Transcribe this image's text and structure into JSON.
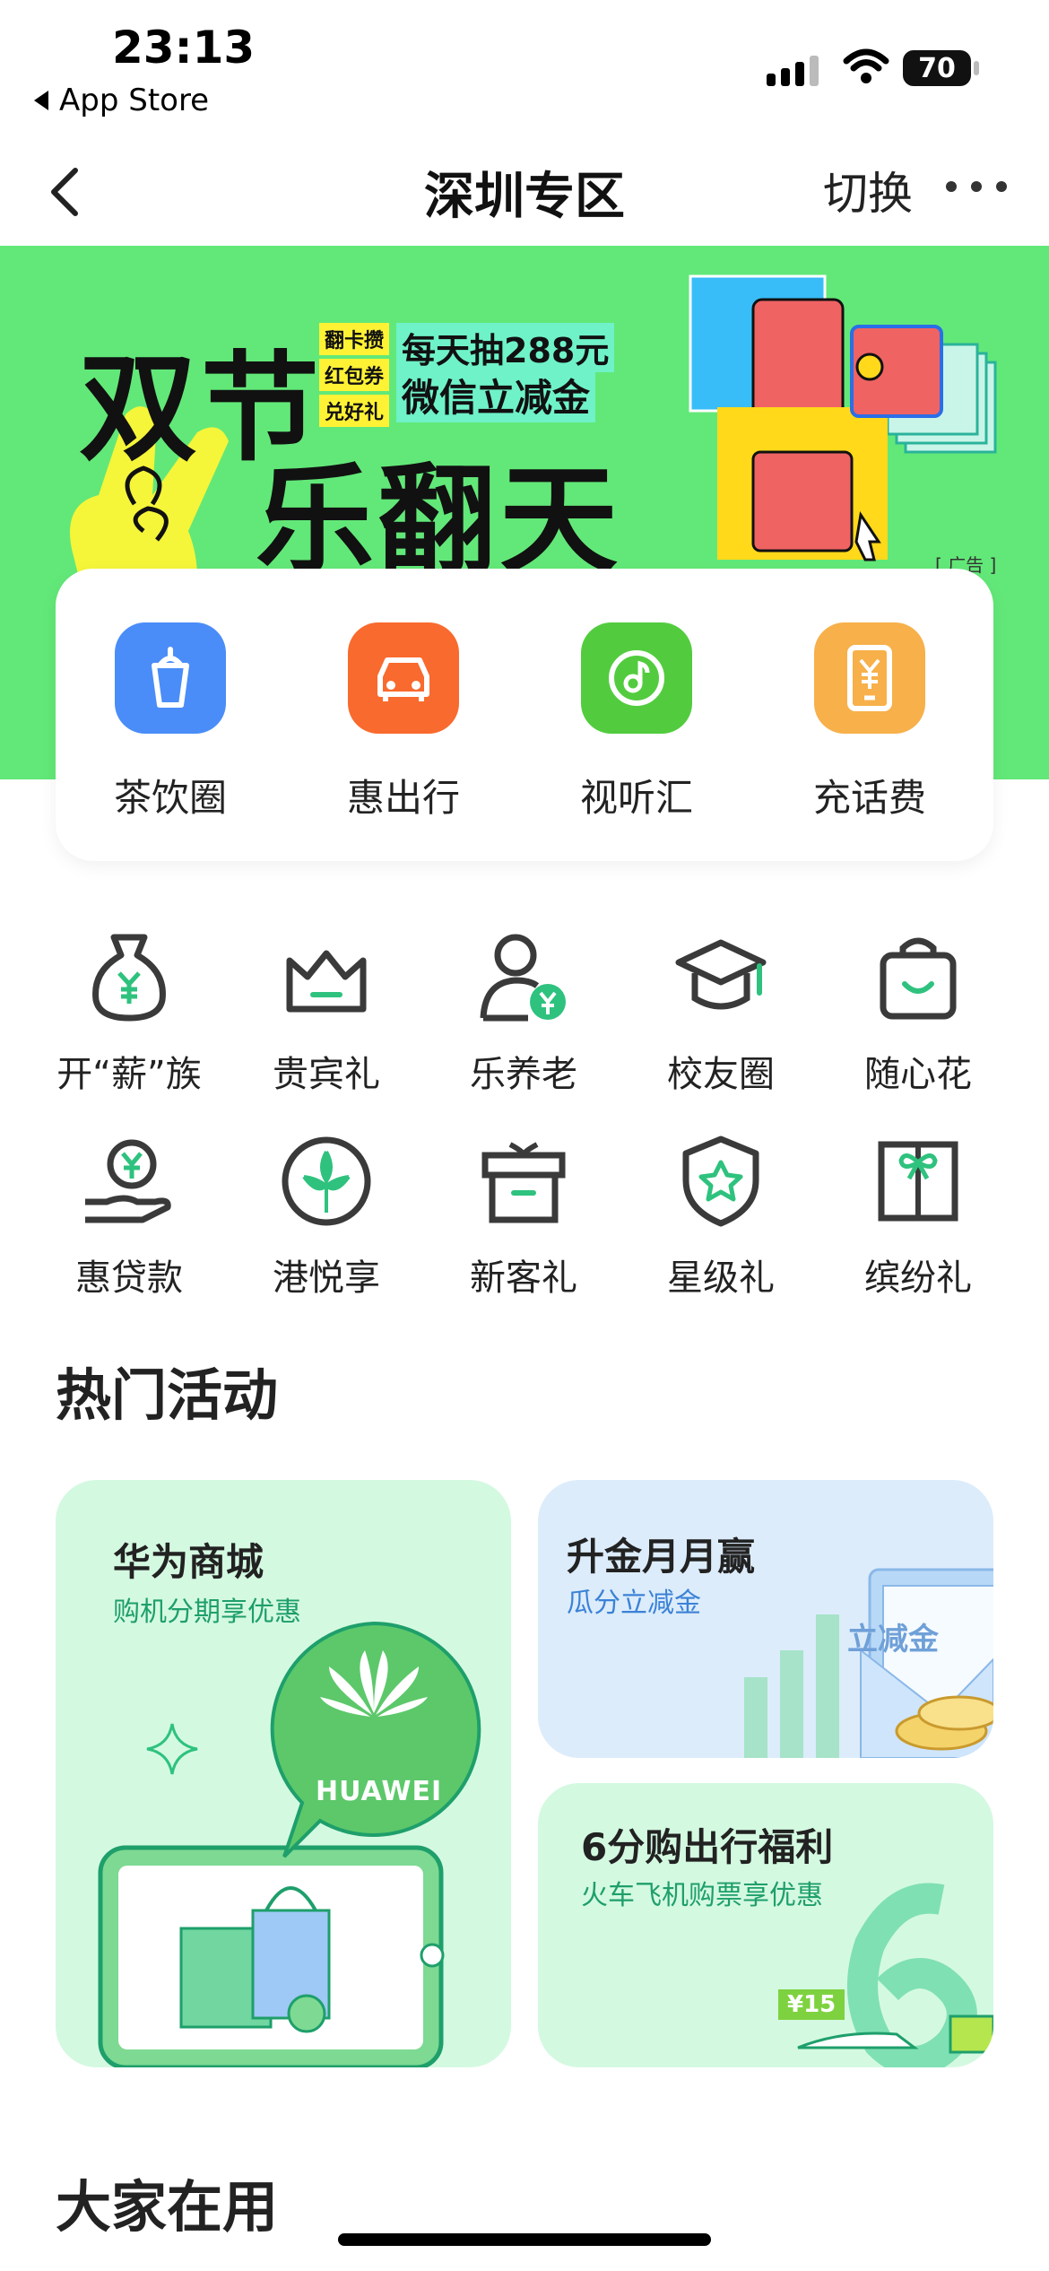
{
  "status_bar": {
    "time": "23:13",
    "back_app_label": "App Store",
    "battery": "70"
  },
  "nav": {
    "title": "深圳专区",
    "switch_label": "切换"
  },
  "banner": {
    "title_line1": "双节",
    "title_line2": "乐翻天",
    "stickers": [
      "翻卡攒",
      "红包券",
      "兑好礼"
    ],
    "promo_line1": "每天抽288元",
    "promo_line2": "微信立减金",
    "ad_tag": "[ 广告 ]",
    "colors": {
      "background": "#62e878",
      "promo_bg": "#6ff2c8",
      "sticker_bg": "#fff235"
    }
  },
  "quick_services": [
    {
      "label": "茶饮圈",
      "icon": "cup-icon",
      "color": "#4a8df8"
    },
    {
      "label": "惠出行",
      "icon": "car-icon",
      "color": "#f96a2e"
    },
    {
      "label": "视听汇",
      "icon": "music-icon",
      "color": "#52cc3e"
    },
    {
      "label": "充话费",
      "icon": "phone-yuan-icon",
      "color": "#f7b04a"
    }
  ],
  "service_grid": [
    {
      "label": "开“薪”族",
      "icon": "money-bag-icon"
    },
    {
      "label": "贵宾礼",
      "icon": "crown-icon"
    },
    {
      "label": "乐养老",
      "icon": "elder-icon"
    },
    {
      "label": "校友圈",
      "icon": "graduation-cap-icon"
    },
    {
      "label": "随心花",
      "icon": "shopping-bag-icon"
    },
    {
      "label": "惠贷款",
      "icon": "loan-hand-icon"
    },
    {
      "label": "港悦享",
      "icon": "bauhinia-icon"
    },
    {
      "label": "新客礼",
      "icon": "gift-box-icon"
    },
    {
      "label": "星级礼",
      "icon": "star-shield-icon"
    },
    {
      "label": "缤纷礼",
      "icon": "present-icon"
    }
  ],
  "hot_activities": {
    "title": "热门活动",
    "cards": [
      {
        "title": "华为商城",
        "subtitle": "购机分期享优惠",
        "brand": "HUAWEI"
      },
      {
        "title": "升金月月赢",
        "subtitle": "瓜分立减金",
        "voucher_text": "立减金"
      },
      {
        "title": "6分购出行福利",
        "subtitle": "火车飞机购票享优惠",
        "price_tag": "¥15"
      }
    ]
  },
  "everyone_using": {
    "title": "大家在用"
  },
  "theme": {
    "accent": "#2ec27e",
    "icon_stroke": "#3a3a3a"
  }
}
